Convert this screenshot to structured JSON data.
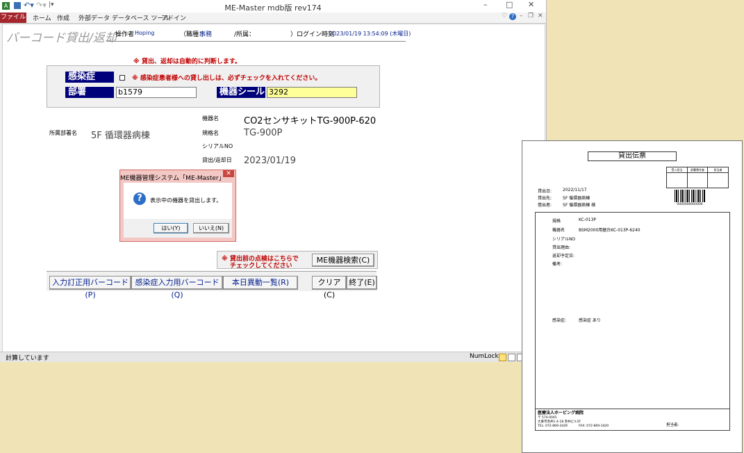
{
  "window": {
    "title": "ME-Master mdb版 rev174"
  },
  "ribbon": {
    "tabs": [
      "ファイル",
      "ホーム",
      "作成",
      "外部データ",
      "データベース ツール",
      "アドイン"
    ]
  },
  "form": {
    "title": "バーコード貸出/返却",
    "operator_label": "操作者",
    "operator_value": "Hoping",
    "job_label": "（職種：",
    "job_value": "事務",
    "dept_label": "/所属：",
    "login_label": "）ログイン時刻",
    "login_value": "2023/01/19 13:54:09 (木曜日)",
    "auto_notice": "※ 貸出、返却は自動的に判断します。",
    "infection_label": "感染症",
    "infection_notice": "※ 感染症患者様への貸し出しは、必ずチェックを入れてください。",
    "dept_field_label": "部署",
    "dept_field_value": "b1579",
    "seal_label": "機器シール",
    "seal_value": "3292",
    "owner_label": "所属部署名",
    "owner_value": "5F  循環器病棟",
    "device_name_label": "機器名",
    "device_name_value": "CO2センサキットTG-900P-620",
    "spec_label": "規格名",
    "spec_value": "TG-900P",
    "serial_label": "シリアルNO",
    "date_label": "貸出/返却日",
    "date_value": "2023/01/19",
    "check_notice_line1": "※ 貸出前の点検はこちらで",
    "check_notice_line2": "チェックしてください",
    "search_button": "ME機器検索(C)",
    "bottom_buttons": [
      "入力訂正用バーコード(P)",
      "感染症入力用バーコード(Q)",
      "本日異動一覧(R)"
    ],
    "clear_button": "クリア(C)",
    "exit_button": "終了(E)"
  },
  "status": {
    "left": "計算しています",
    "numlock": "NumLock"
  },
  "dialog": {
    "title": "ME機器管理システム「ME-Master」",
    "message": "表示中の機器を貸出します。",
    "yes": "はい(Y)",
    "no": "いいえ(N)"
  },
  "slip": {
    "title": "貸出伝票",
    "stamp_headers": [
      "受入担当",
      "部署責任者",
      "担当者"
    ],
    "date_label": "貸出日:",
    "date_value": "2022/11/17",
    "dest_label": "貸出先:",
    "dest_value": "5F 循環器病棟",
    "borrower_label": "借出者:",
    "borrower_value": "5F 循環器病棟 様",
    "barcode_number": "0000000000006",
    "rows": [
      {
        "label": "規格",
        "value": "KC-013P"
      },
      {
        "label": "機器名",
        "value": "BSM2000用据台KC-013P-6240"
      },
      {
        "label": "シリアルNO",
        "value": ""
      },
      {
        "label": "貸出理由:",
        "value": ""
      },
      {
        "label": "返却予定日:",
        "value": ""
      },
      {
        "label": "備考:",
        "value": ""
      }
    ],
    "infection_label": "感染症:",
    "infection_value": "感染症 あり",
    "hospital": "医療法人ホーピング病院",
    "postal": "〒 574-0045",
    "address": "大東市赤井1-4-18 赤井ビル5F",
    "tel": "TEL:  072-869-3429",
    "fax": "FAX:  072-869-3420",
    "person_in_charge": "担当者:"
  }
}
